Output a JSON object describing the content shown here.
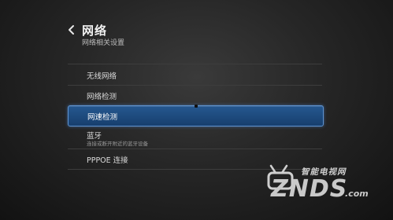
{
  "header": {
    "title": "网络",
    "subtitle": "网络相关设置"
  },
  "menu": {
    "items": [
      {
        "label": "无线网络"
      },
      {
        "label": "网络检测"
      },
      {
        "label": "网速检测",
        "selected": true
      },
      {
        "label": "蓝牙",
        "description": "连接或断开附近的蓝牙设备"
      },
      {
        "label": "PPPOE 连接"
      }
    ]
  },
  "watermark": {
    "top_text": "智能电视网",
    "main_text": "ZNDS",
    "suffix": ".com"
  },
  "colors": {
    "selected_fill": "#1f4c82",
    "selected_border": "#5f93cf",
    "background": "#262626"
  },
  "icons": {
    "back": "chevron-left-icon",
    "logo": "tv-antenna-logo-icon"
  }
}
